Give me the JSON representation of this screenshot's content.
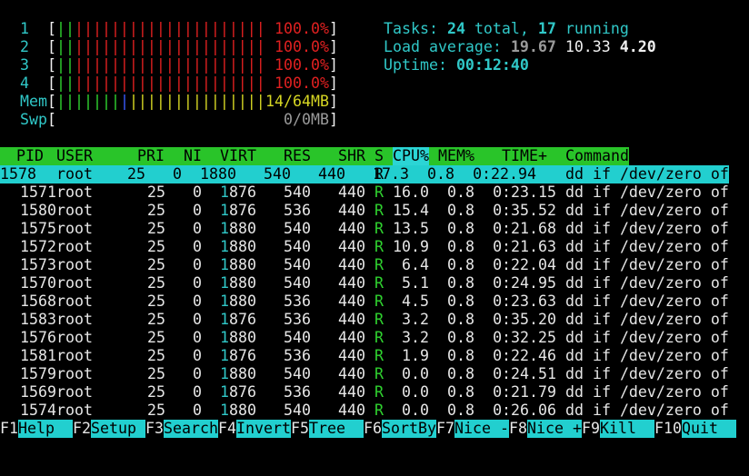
{
  "cpus": [
    {
      "id": "1",
      "percent": "100.0%"
    },
    {
      "id": "2",
      "percent": "100.0%"
    },
    {
      "id": "3",
      "percent": "100.0%"
    },
    {
      "id": "4",
      "percent": "100.0%"
    }
  ],
  "mem": {
    "label": "Mem",
    "value": "14/64MB"
  },
  "swp": {
    "label": "Swp",
    "value": "0/0MB"
  },
  "tasks": {
    "label": "Tasks:",
    "total": "24",
    "total_suffix": "total,",
    "running": "17",
    "running_suffix": "running"
  },
  "load": {
    "label": "Load average:",
    "v1": "19.67",
    "v2": "10.33",
    "v3": "4.20"
  },
  "uptime": {
    "label": "Uptime:",
    "value": "00:12:40"
  },
  "columns": {
    "pid": "PID",
    "user": "USER",
    "pri": "PRI",
    "ni": "NI",
    "virt": "VIRT",
    "res": "RES",
    "shr": "SHR",
    "s": "S",
    "cpu": "CPU%",
    "mem": "MEM%",
    "time": "TIME+",
    "command": "Command"
  },
  "processes": [
    {
      "pid": "1578",
      "user": "root",
      "pri": "25",
      "ni": "0",
      "virt": "1880",
      "res": "540",
      "shr": "440",
      "s": "R",
      "cpu": "17.3",
      "mem": "0.8",
      "time": "0:22.94",
      "command": "dd if /dev/zero of"
    },
    {
      "pid": "1571",
      "user": "root",
      "pri": "25",
      "ni": "0",
      "virt": "1876",
      "res": "540",
      "shr": "440",
      "s": "R",
      "cpu": "16.0",
      "mem": "0.8",
      "time": "0:23.15",
      "command": "dd if /dev/zero of"
    },
    {
      "pid": "1580",
      "user": "root",
      "pri": "25",
      "ni": "0",
      "virt": "1876",
      "res": "536",
      "shr": "440",
      "s": "R",
      "cpu": "15.4",
      "mem": "0.8",
      "time": "0:35.52",
      "command": "dd if /dev/zero of"
    },
    {
      "pid": "1575",
      "user": "root",
      "pri": "25",
      "ni": "0",
      "virt": "1880",
      "res": "540",
      "shr": "440",
      "s": "R",
      "cpu": "13.5",
      "mem": "0.8",
      "time": "0:21.68",
      "command": "dd if /dev/zero of"
    },
    {
      "pid": "1572",
      "user": "root",
      "pri": "25",
      "ni": "0",
      "virt": "1880",
      "res": "540",
      "shr": "440",
      "s": "R",
      "cpu": "10.9",
      "mem": "0.8",
      "time": "0:21.63",
      "command": "dd if /dev/zero of"
    },
    {
      "pid": "1573",
      "user": "root",
      "pri": "25",
      "ni": "0",
      "virt": "1880",
      "res": "540",
      "shr": "440",
      "s": "R",
      "cpu": "6.4",
      "mem": "0.8",
      "time": "0:22.04",
      "command": "dd if /dev/zero of"
    },
    {
      "pid": "1570",
      "user": "root",
      "pri": "25",
      "ni": "0",
      "virt": "1880",
      "res": "540",
      "shr": "440",
      "s": "R",
      "cpu": "5.1",
      "mem": "0.8",
      "time": "0:24.95",
      "command": "dd if /dev/zero of"
    },
    {
      "pid": "1568",
      "user": "root",
      "pri": "25",
      "ni": "0",
      "virt": "1880",
      "res": "536",
      "shr": "440",
      "s": "R",
      "cpu": "4.5",
      "mem": "0.8",
      "time": "0:23.63",
      "command": "dd if /dev/zero of"
    },
    {
      "pid": "1583",
      "user": "root",
      "pri": "25",
      "ni": "0",
      "virt": "1876",
      "res": "536",
      "shr": "440",
      "s": "R",
      "cpu": "3.2",
      "mem": "0.8",
      "time": "0:35.20",
      "command": "dd if /dev/zero of"
    },
    {
      "pid": "1576",
      "user": "root",
      "pri": "25",
      "ni": "0",
      "virt": "1880",
      "res": "540",
      "shr": "440",
      "s": "R",
      "cpu": "3.2",
      "mem": "0.8",
      "time": "0:32.25",
      "command": "dd if /dev/zero of"
    },
    {
      "pid": "1581",
      "user": "root",
      "pri": "25",
      "ni": "0",
      "virt": "1876",
      "res": "536",
      "shr": "440",
      "s": "R",
      "cpu": "1.9",
      "mem": "0.8",
      "time": "0:22.46",
      "command": "dd if /dev/zero of"
    },
    {
      "pid": "1579",
      "user": "root",
      "pri": "25",
      "ni": "0",
      "virt": "1880",
      "res": "540",
      "shr": "440",
      "s": "R",
      "cpu": "0.0",
      "mem": "0.8",
      "time": "0:24.51",
      "command": "dd if /dev/zero of"
    },
    {
      "pid": "1569",
      "user": "root",
      "pri": "25",
      "ni": "0",
      "virt": "1876",
      "res": "536",
      "shr": "440",
      "s": "R",
      "cpu": "0.0",
      "mem": "0.8",
      "time": "0:21.79",
      "command": "dd if /dev/zero of"
    },
    {
      "pid": "1574",
      "user": "root",
      "pri": "25",
      "ni": "0",
      "virt": "1880",
      "res": "540",
      "shr": "440",
      "s": "R",
      "cpu": "0.0",
      "mem": "0.8",
      "time": "0:26.06",
      "command": "dd if /dev/zero of"
    }
  ],
  "function_keys": [
    {
      "key": "F1",
      "label": "Help  "
    },
    {
      "key": "F2",
      "label": "Setup "
    },
    {
      "key": "F3",
      "label": "Search"
    },
    {
      "key": "F4",
      "label": "Invert"
    },
    {
      "key": "F5",
      "label": "Tree  "
    },
    {
      "key": "F6",
      "label": "SortBy"
    },
    {
      "key": "F7",
      "label": "Nice -"
    },
    {
      "key": "F8",
      "label": "Nice +"
    },
    {
      "key": "F9",
      "label": "Kill  "
    },
    {
      "key": "F10",
      "label": "Quit  "
    }
  ]
}
